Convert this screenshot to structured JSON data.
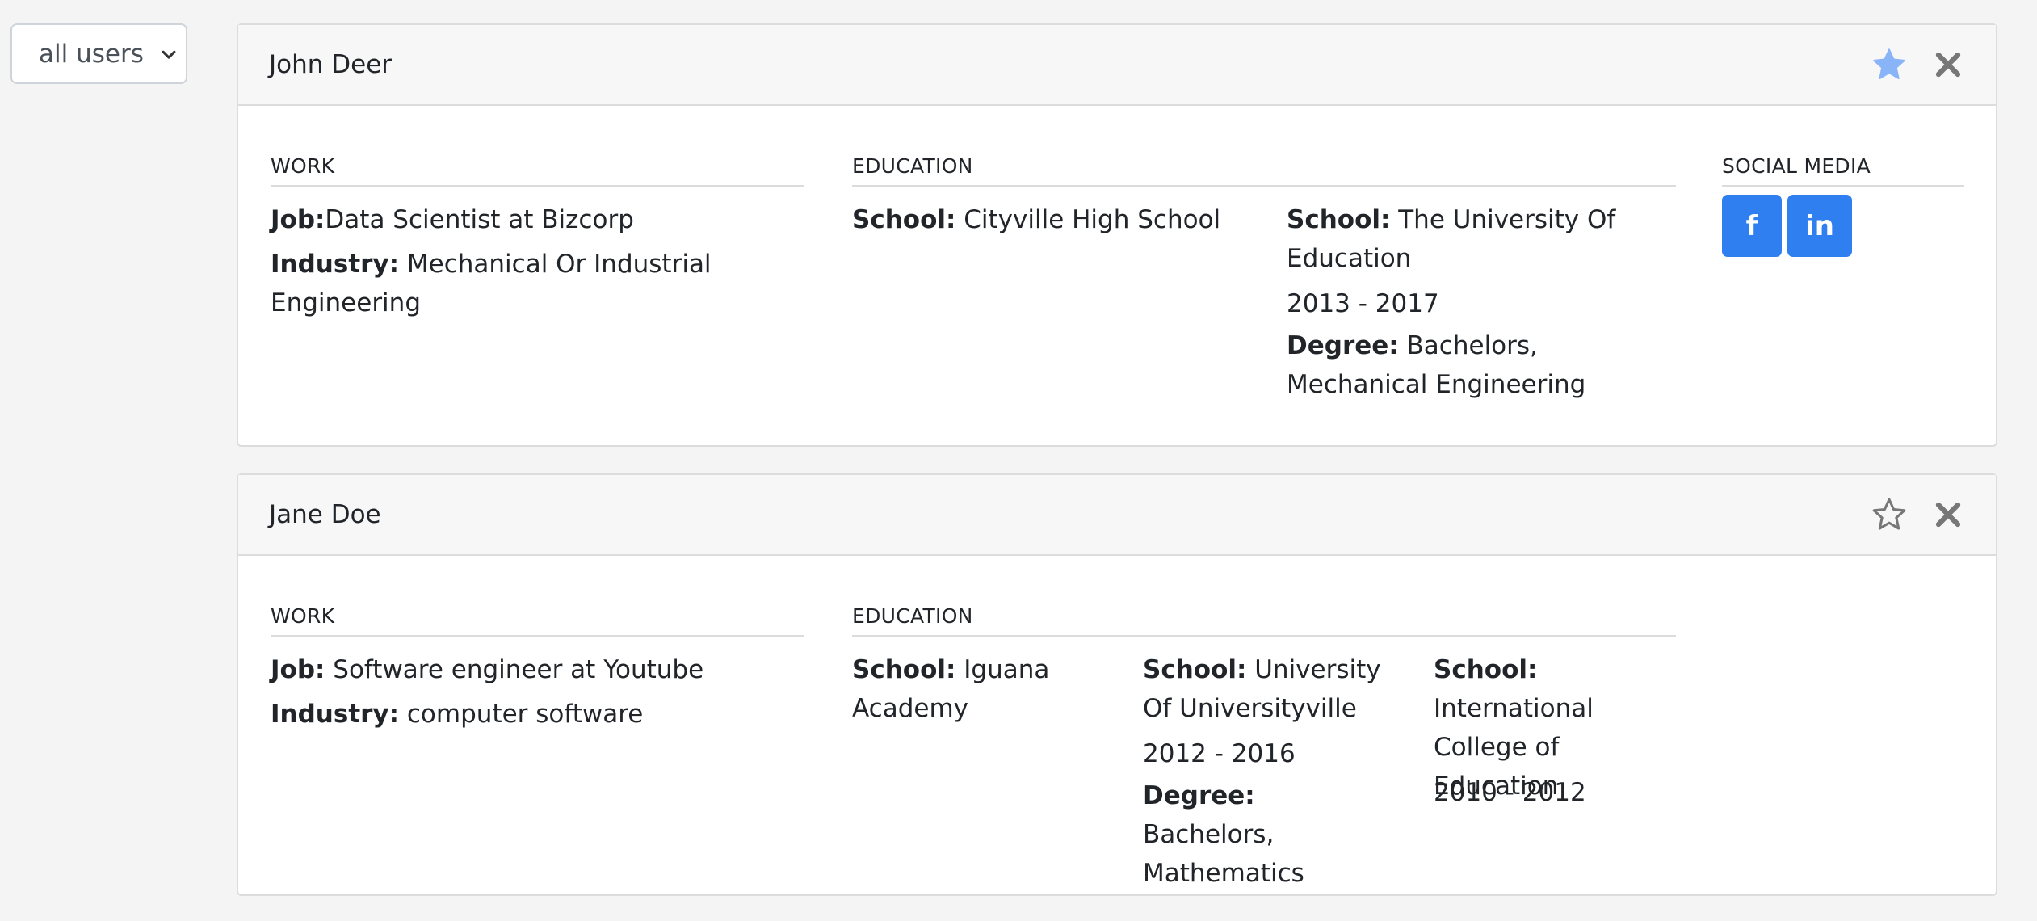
{
  "filter": {
    "selected": "all users"
  },
  "users": [
    {
      "name": "John Deer",
      "starred": true,
      "work": {
        "title": "WORK",
        "job_label": "Job:",
        "job": "Data Scientist at Bizcorp",
        "industry_label": "Industry:",
        "industry": " Mechanical Or Industrial Engineering"
      },
      "education": {
        "title": "EDUCATION",
        "schools": [
          {
            "school_label": "School:",
            "school": " Cityville High School"
          },
          {
            "school_label": "School:",
            "school": " The University Of Education",
            "years": "2013 - 2017",
            "degree_label": "Degree:",
            "degree": " Bachelors, Mechanical Engineering"
          }
        ]
      },
      "social": {
        "title": "SOCIAL MEDIA",
        "facebook_label": "f",
        "linkedin_label": "in"
      }
    },
    {
      "name": "Jane Doe",
      "starred": false,
      "work": {
        "title": "WORK",
        "job_label": "Job:",
        "job": " Software engineer at Youtube",
        "industry_label": "Industry:",
        "industry": " computer software"
      },
      "education": {
        "title": "EDUCATION",
        "schools": [
          {
            "school_label": "School:",
            "school": " Iguana Academy"
          },
          {
            "school_label": "School:",
            "school": " University Of Universityville",
            "years": "2012 - 2016",
            "degree_label": "Degree:",
            "degree": " Bachelors, Mathematics"
          },
          {
            "school_label": "School:",
            "school": "International College of Education",
            "years": "2010 - 2012"
          }
        ]
      }
    }
  ],
  "colors": {
    "star_filled": "#8ab4f8",
    "icon_gray": "#777777",
    "social_blue": "#2f7ff0"
  }
}
